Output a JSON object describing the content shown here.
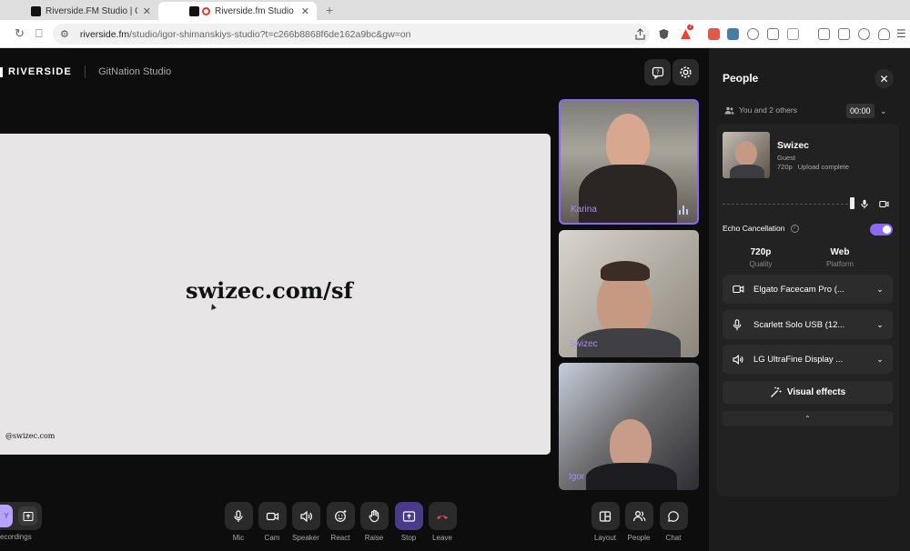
{
  "browser": {
    "tabs": [
      {
        "title": "Riverside.FM Studio | GitNation St"
      },
      {
        "title": "Riverside.fm Studio | GitNat"
      }
    ],
    "url_host": "riverside.fm",
    "url_path": "/studio/igor-shimanskiys-studio?t=c266b8868f6de162a9bc&gw=on",
    "badge_count": "7"
  },
  "header": {
    "brand": "RIVERSIDE",
    "studio": "GitNation Studio"
  },
  "stage": {
    "slide_text": "swizec.com/sf",
    "handle": "@swizec.com"
  },
  "tiles": [
    {
      "name": "Karina"
    },
    {
      "name": "Swizec"
    },
    {
      "name": "Igor"
    }
  ],
  "controls": {
    "left": {
      "recordings_label": "ecordings"
    },
    "center": [
      {
        "label": "Mic",
        "icon": "mic-icon"
      },
      {
        "label": "Cam",
        "icon": "camera-icon"
      },
      {
        "label": "Speaker",
        "icon": "speaker-icon"
      },
      {
        "label": "React",
        "icon": "emoji-icon"
      },
      {
        "label": "Raise",
        "icon": "hand-icon"
      },
      {
        "label": "Stop",
        "icon": "share-stop-icon"
      },
      {
        "label": "Leave",
        "icon": "phone-hangup-icon"
      }
    ],
    "right": [
      {
        "label": "Layout",
        "icon": "layout-icon"
      },
      {
        "label": "People",
        "icon": "people-icon"
      },
      {
        "label": "Chat",
        "icon": "chat-icon"
      }
    ]
  },
  "people": {
    "title": "People",
    "summary": "You and 2 others",
    "timer": "00:00",
    "participant": {
      "name": "Swizec",
      "role": "Guest",
      "quality": "720p",
      "upload": "Upload complete"
    },
    "echo_label": "Echo Cancellation",
    "echo_on": true,
    "stats": [
      {
        "value": "720p",
        "label": "Quality"
      },
      {
        "value": "Web",
        "label": "Platform"
      }
    ],
    "devices": [
      {
        "label": "Elgato Facecam Pro (...",
        "icon": "camera-icon"
      },
      {
        "label": "Scarlett Solo USB (12...",
        "icon": "mic-icon"
      },
      {
        "label": "LG UltraFine Display ...",
        "icon": "speaker-icon"
      }
    ],
    "visual_effects": "Visual effects"
  },
  "colors": {
    "accent": "#8b6af0",
    "leave": "#e5484d"
  }
}
